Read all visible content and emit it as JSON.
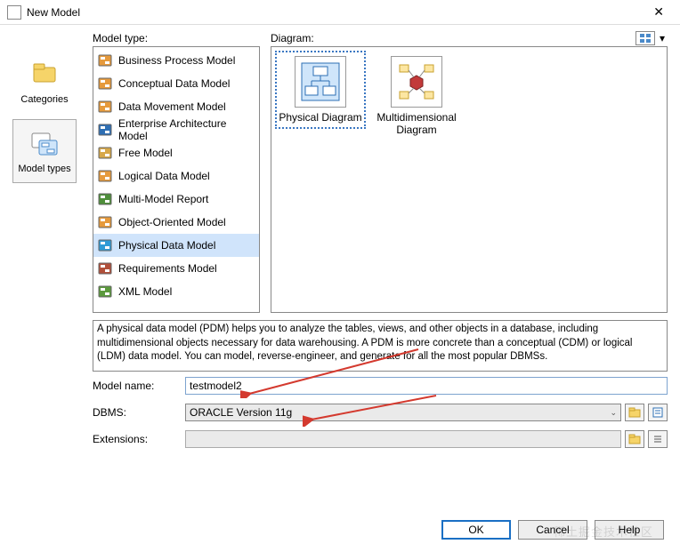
{
  "window": {
    "title": "New Model"
  },
  "nav": {
    "items": [
      {
        "label": "Categories"
      },
      {
        "label": "Model types"
      }
    ],
    "selected": 1
  },
  "modelTypes": {
    "header": "Model type:",
    "items": [
      "Business Process Model",
      "Conceptual Data Model",
      "Data Movement Model",
      "Enterprise Architecture Model",
      "Free Model",
      "Logical Data Model",
      "Multi-Model Report",
      "Object-Oriented Model",
      "Physical Data Model",
      "Requirements Model",
      "XML Model"
    ],
    "selected": 8,
    "iconColors": [
      "#E69A3C",
      "#E69A3C",
      "#E69A3C",
      "#2E6FB4",
      "#D7A84A",
      "#E69A3C",
      "#4E8F3A",
      "#E69A3C",
      "#2E9BD6",
      "#B14F3A",
      "#5B9A3C"
    ]
  },
  "diagram": {
    "header": "Diagram:",
    "items": [
      {
        "label": "Physical Diagram"
      },
      {
        "label": "Multidimensional Diagram"
      }
    ],
    "selected": 0
  },
  "description": "A physical data model (PDM) helps you to analyze the tables, views, and other objects in a database, including multidimensional objects necessary for data warehousing. A PDM is more concrete than a conceptual (CDM) or logical (LDM) data model. You can model, reverse-engineer, and generate for all the most popular DBMSs.",
  "form": {
    "modelName": {
      "label": "Model name:",
      "value": "testmodel2"
    },
    "dbms": {
      "label": "DBMS:",
      "value": "ORACLE Version 11g"
    },
    "extensions": {
      "label": "Extensions:",
      "value": ""
    }
  },
  "buttons": {
    "ok": "OK",
    "cancel": "Cancel",
    "help": "Help"
  },
  "watermark": "稀土掘金技术社区"
}
